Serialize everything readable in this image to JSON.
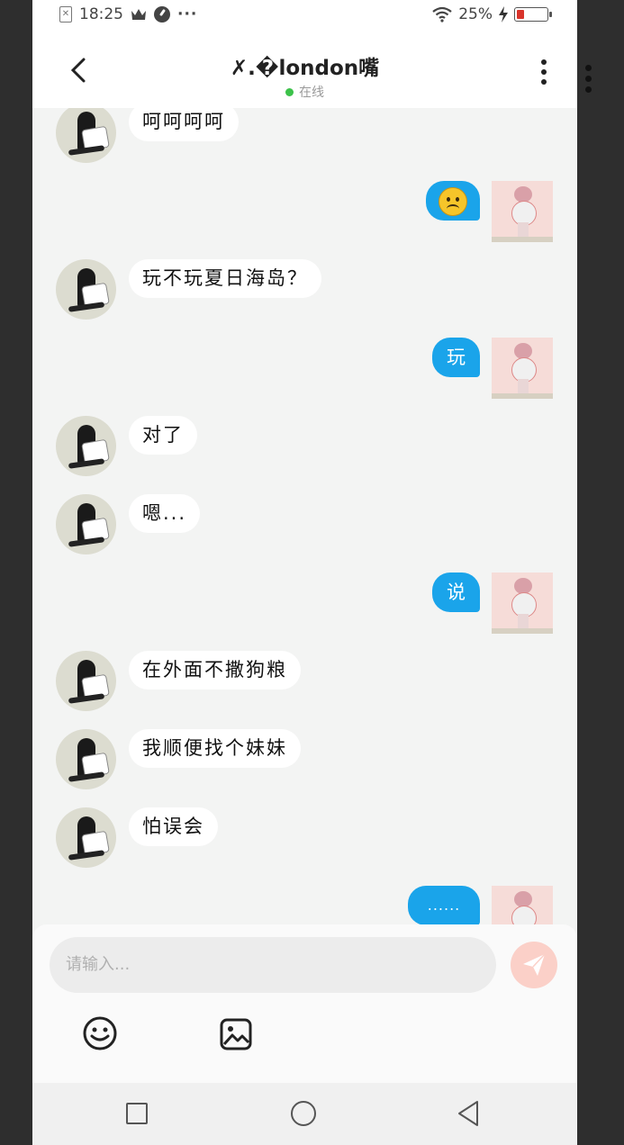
{
  "status_bar": {
    "time": "18:25",
    "extra": "···",
    "battery_text": "25%",
    "battery_level": 0.25,
    "icons": [
      "sim-icon",
      "crown-icon",
      "speed-icon",
      "wifi-icon",
      "charging-icon",
      "battery-icon"
    ]
  },
  "header": {
    "title": "✗.�london嘴",
    "status": "在线",
    "back_icon": "chevron-left-icon",
    "more_icon": "more-vertical-icon"
  },
  "messages": [
    {
      "side": "left",
      "text": "呵呵呵呵"
    },
    {
      "side": "right",
      "text": "",
      "emoji": "frowning-face"
    },
    {
      "side": "left",
      "text": "玩不玩夏日海岛？"
    },
    {
      "side": "right",
      "text": "玩"
    },
    {
      "side": "left",
      "text": "对了"
    },
    {
      "side": "left",
      "text": "嗯..."
    },
    {
      "side": "right",
      "text": "说"
    },
    {
      "side": "left",
      "text": "在外面不撒狗粮"
    },
    {
      "side": "left",
      "text": "我顺便找个妹妹"
    },
    {
      "side": "left",
      "text": "怕误会"
    },
    {
      "side": "right",
      "text": "......"
    }
  ],
  "composer": {
    "placeholder": "请输入...",
    "send_icon": "send-icon",
    "emoji_icon": "smiley-icon",
    "image_icon": "image-icon"
  },
  "navbar": {
    "icons": [
      "recent-apps-icon",
      "home-icon",
      "back-triangle-icon"
    ]
  },
  "colors": {
    "accent": "#1aa4ea",
    "send_button": "#fbd0c8",
    "online_dot": "#3cc24a",
    "background": "#f3f4f3"
  }
}
